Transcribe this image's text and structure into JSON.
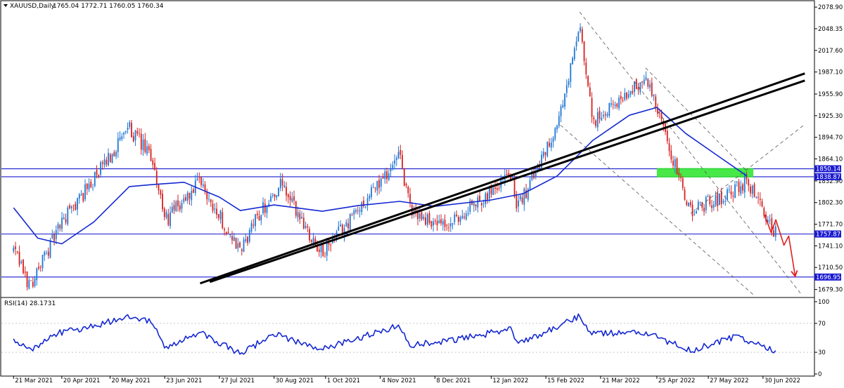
{
  "header": {
    "symbol_label": "XAUUSD,Daily",
    "ohlc_text": "1765.04 1772.71 1760.05 1760.34"
  },
  "rsi": {
    "label": "RSI(14) 28.1731",
    "ticks": [
      "100",
      "70",
      "30",
      "0"
    ]
  },
  "colors": {
    "candle_up": "#1f77d4",
    "candle_down": "#d62020",
    "ma_line": "#1428d2",
    "level_line": "#1a1ad0",
    "trend_line": "#000000",
    "channel_line": "#555555",
    "zone_fill": "#33e633",
    "forecast_arrow": "#e02020",
    "rsi_line": "#1428d2"
  },
  "chart_data": {
    "type": "candlestick",
    "symbol": "XAUUSD",
    "timeframe": "Daily",
    "ohlc_last": {
      "open": 1765.04,
      "high": 1772.71,
      "low": 1760.05,
      "close": 1760.34
    },
    "price_ticks": [
      "2078.90",
      "2048.35",
      "2017.60",
      "1987.10",
      "1955.90",
      "1925.30",
      "1894.70",
      "1864.10",
      "1832.90",
      "1802.30",
      "1771.70",
      "1741.10",
      "1710.50",
      "1679.30"
    ],
    "price_range": [
      1669,
      2086
    ],
    "date_ticks": [
      "21 Mar 2021",
      "20 Apr 2021",
      "20 May 2021",
      "23 Jun 2021",
      "27 Jul 2021",
      "30 Aug 2021",
      "1 Oct 2021",
      "4 Nov 2021",
      "8 Dec 2021",
      "12 Jan 2022",
      "15 Feb 2022",
      "21 Mar 2022",
      "25 Apr 2022",
      "27 May 2022",
      "30 Jun 2022"
    ],
    "key_points": [
      {
        "date": "2021-03-21",
        "close": 1735
      },
      {
        "date": "2021-03-31",
        "close": 1684
      },
      {
        "date": "2021-04-20",
        "close": 1775
      },
      {
        "date": "2021-05-10",
        "close": 1835
      },
      {
        "date": "2021-06-01",
        "close": 1908
      },
      {
        "date": "2021-06-16",
        "close": 1860
      },
      {
        "date": "2021-06-23",
        "close": 1776
      },
      {
        "date": "2021-07-15",
        "close": 1830
      },
      {
        "date": "2021-08-09",
        "close": 1732
      },
      {
        "date": "2021-08-20",
        "close": 1785
      },
      {
        "date": "2021-09-03",
        "close": 1827
      },
      {
        "date": "2021-09-29",
        "close": 1730
      },
      {
        "date": "2021-11-16",
        "close": 1866
      },
      {
        "date": "2021-11-23",
        "close": 1790
      },
      {
        "date": "2021-12-15",
        "close": 1765
      },
      {
        "date": "2022-01-25",
        "close": 1847
      },
      {
        "date": "2022-01-28",
        "close": 1791
      },
      {
        "date": "2022-02-24",
        "close": 1925
      },
      {
        "date": "2022-03-08",
        "close": 2050
      },
      {
        "date": "2022-03-16",
        "close": 1915
      },
      {
        "date": "2022-04-18",
        "close": 1980
      },
      {
        "date": "2022-05-16",
        "close": 1790
      },
      {
        "date": "2022-06-13",
        "close": 1820
      },
      {
        "date": "2022-06-20",
        "close": 1835
      },
      {
        "date": "2022-07-05",
        "close": 1765
      },
      {
        "date": "2022-07-08",
        "close": 1760.34
      }
    ],
    "price_labels": [
      "1850.14",
      "1838.87",
      "1757.87",
      "1696.95"
    ],
    "ma_points": [
      {
        "date": "2021-03-21",
        "value": 1795
      },
      {
        "date": "2021-04-05",
        "value": 1752
      },
      {
        "date": "2021-04-20",
        "value": 1744
      },
      {
        "date": "2021-05-10",
        "value": 1775
      },
      {
        "date": "2021-06-01",
        "value": 1825
      },
      {
        "date": "2021-06-16",
        "value": 1828
      },
      {
        "date": "2021-07-05",
        "value": 1831
      },
      {
        "date": "2021-07-27",
        "value": 1810
      },
      {
        "date": "2021-08-09",
        "value": 1791
      },
      {
        "date": "2021-08-30",
        "value": 1799
      },
      {
        "date": "2021-09-29",
        "value": 1790
      },
      {
        "date": "2021-10-21",
        "value": 1798
      },
      {
        "date": "2021-11-16",
        "value": 1804
      },
      {
        "date": "2021-12-08",
        "value": 1797
      },
      {
        "date": "2022-01-12",
        "value": 1806
      },
      {
        "date": "2022-02-01",
        "value": 1815
      },
      {
        "date": "2022-02-22",
        "value": 1840
      },
      {
        "date": "2022-03-16",
        "value": 1890
      },
      {
        "date": "2022-04-08",
        "value": 1926
      },
      {
        "date": "2022-04-25",
        "value": 1937
      },
      {
        "date": "2022-05-13",
        "value": 1900
      },
      {
        "date": "2022-06-01",
        "value": 1870
      },
      {
        "date": "2022-06-20",
        "value": 1840
      }
    ],
    "rsi_range": [
      0,
      100
    ],
    "rsi_points": [
      {
        "date": "2021-03-21",
        "value": 45
      },
      {
        "date": "2021-03-31",
        "value": 34
      },
      {
        "date": "2021-04-20",
        "value": 58
      },
      {
        "date": "2021-05-10",
        "value": 66
      },
      {
        "date": "2021-06-01",
        "value": 80
      },
      {
        "date": "2021-06-16",
        "value": 72
      },
      {
        "date": "2021-06-23",
        "value": 34
      },
      {
        "date": "2021-07-15",
        "value": 58
      },
      {
        "date": "2021-08-09",
        "value": 28
      },
      {
        "date": "2021-08-30",
        "value": 55
      },
      {
        "date": "2021-09-29",
        "value": 34
      },
      {
        "date": "2021-11-16",
        "value": 68
      },
      {
        "date": "2021-11-23",
        "value": 40
      },
      {
        "date": "2021-12-15",
        "value": 45
      },
      {
        "date": "2022-01-25",
        "value": 62
      },
      {
        "date": "2022-01-28",
        "value": 40
      },
      {
        "date": "2022-02-24",
        "value": 68
      },
      {
        "date": "2022-03-08",
        "value": 80
      },
      {
        "date": "2022-03-16",
        "value": 55
      },
      {
        "date": "2022-04-18",
        "value": 58
      },
      {
        "date": "2022-05-16",
        "value": 32
      },
      {
        "date": "2022-06-13",
        "value": 52
      },
      {
        "date": "2022-07-05",
        "value": 34
      },
      {
        "date": "2022-07-08",
        "value": 28
      }
    ],
    "rsi_ticks": [
      100,
      70,
      30,
      0
    ],
    "horizontal_levels": [
      1850.14,
      1838.87,
      1757.87,
      1696.95
    ],
    "support_zone": {
      "start": "2022-04-25",
      "end": "2022-06-24",
      "low": 1838.87,
      "high": 1850.14
    },
    "trend_lines": [
      {
        "from": {
          "date": "2021-07-15",
          "price": 1688
        },
        "to": {
          "date": "2022-07-26",
          "price": 1985
        }
      },
      {
        "from": {
          "date": "2021-07-21",
          "price": 1690
        },
        "to": {
          "date": "2022-07-26",
          "price": 1975
        }
      }
    ],
    "channel_lines": [
      {
        "from": {
          "date": "2022-03-08",
          "price": 2072
        },
        "to": {
          "date": "2022-07-24",
          "price": 1672
        }
      },
      {
        "from": {
          "date": "2022-02-24",
          "price": 1912
        },
        "to": {
          "date": "2022-06-24",
          "price": 1672
        }
      },
      {
        "from": {
          "date": "2022-04-18",
          "price": 1993
        },
        "to": {
          "date": "2022-06-20",
          "price": 1847
        }
      },
      {
        "from": {
          "date": "2022-05-16",
          "price": 1787
        },
        "to": {
          "date": "2022-07-26",
          "price": 1913
        }
      }
    ],
    "forecast_path": [
      {
        "date": "2022-07-01",
        "price": 1785
      },
      {
        "date": "2022-07-05",
        "price": 1760
      },
      {
        "date": "2022-07-08",
        "price": 1778
      },
      {
        "date": "2022-07-13",
        "price": 1742
      },
      {
        "date": "2022-07-16",
        "price": 1755
      },
      {
        "date": "2022-07-20",
        "price": 1698
      }
    ]
  }
}
